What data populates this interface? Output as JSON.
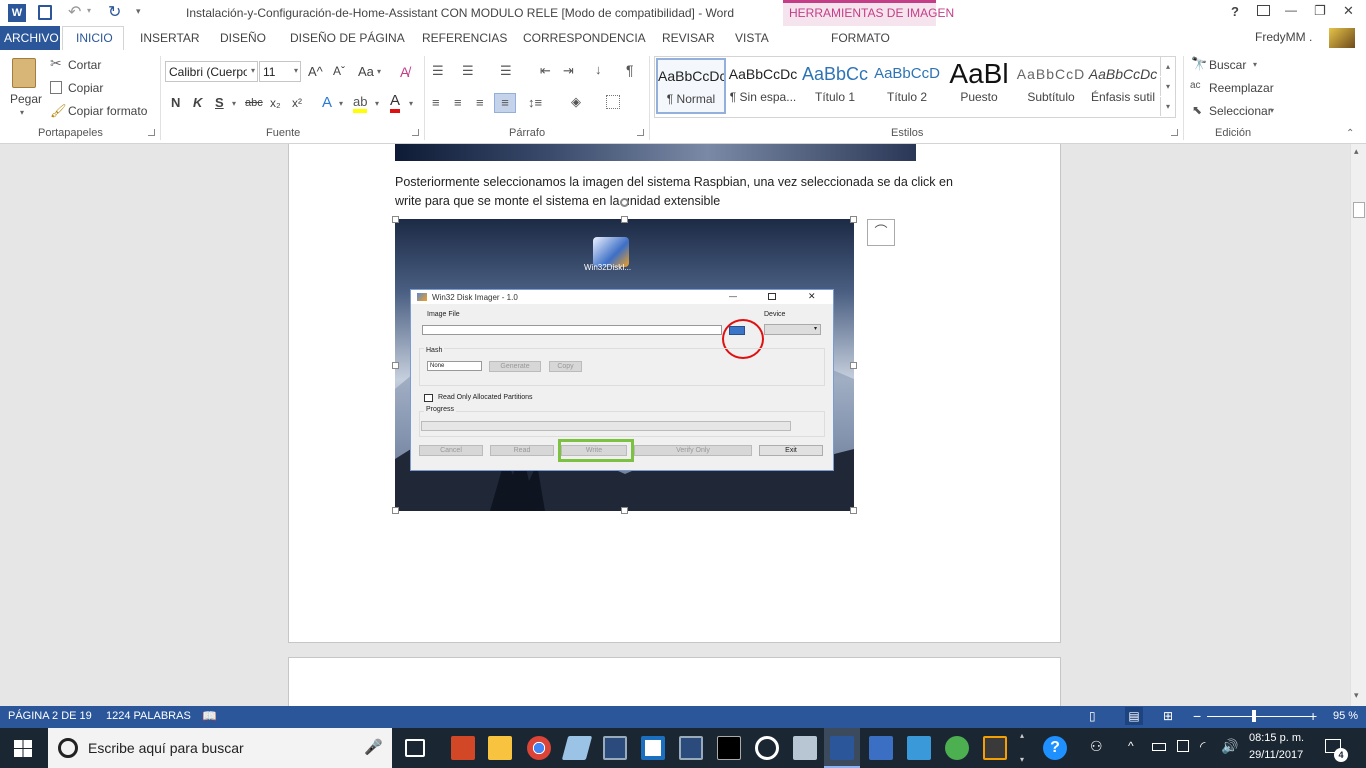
{
  "titlebar": {
    "title": "Instalación-y-Configuración-de-Home-Assistant CON MODULO RELE [Modo de compatibilidad] - Word",
    "contextual_group": "HERRAMIENTAS DE IMAGEN",
    "help": "?",
    "minimize": "—",
    "restore": "❐",
    "close": "✕"
  },
  "tabs": {
    "file": "ARCHIVO",
    "home": "INICIO",
    "insert": "INSERTAR",
    "design": "DISEÑO",
    "layout": "DISEÑO DE PÁGINA",
    "references": "REFERENCIAS",
    "mailings": "CORRESPONDENCIA",
    "review": "REVISAR",
    "view": "VISTA",
    "format": "FORMATO",
    "user": "FredyMM ."
  },
  "clipboard": {
    "paste": "Pegar",
    "cut": "Cortar",
    "copy": "Copiar",
    "format_painter": "Copiar formato",
    "label": "Portapapeles"
  },
  "font": {
    "name": "Calibri (Cuerpo",
    "size": "11",
    "bold": "N",
    "italic": "K",
    "underline": "S",
    "strike": "abc",
    "subscript": "x₂",
    "superscript": "x²",
    "grow": "A^",
    "shrink": "Aˇ",
    "case": "Aa",
    "label": "Fuente"
  },
  "paragraph": {
    "label": "Párrafo",
    "pilcrow": "¶"
  },
  "styles": {
    "items": [
      {
        "preview": "AaBbCcDc",
        "name": "¶ Normal"
      },
      {
        "preview": "AaBbCcDc",
        "name": "¶ Sin espa..."
      },
      {
        "preview": "AaBbCc",
        "name": "Título 1"
      },
      {
        "preview": "AaBbCcD",
        "name": "Título 2"
      },
      {
        "preview": "AaBl",
        "name": "Puesto"
      },
      {
        "preview": "AaBbCcD",
        "name": "Subtítulo"
      },
      {
        "preview": "AaBbCcDc",
        "name": "Énfasis sutil"
      }
    ],
    "label": "Estilos"
  },
  "editing": {
    "find": "Buscar",
    "replace": "Reemplazar",
    "select": "Seleccionar",
    "label": "Edición"
  },
  "document": {
    "paragraph_line1": "Posteriormente seleccionamos la imagen del sistema Raspbian, una vez seleccionada se da click en",
    "paragraph_line2": "write para que se monte el sistema en la unidad extensible"
  },
  "screenshot": {
    "desktop_icon_label": "Win32DiskI...",
    "dialog_title": "Win32 Disk Imager - 1.0",
    "image_file_label": "Image File",
    "device_label": "Device",
    "hash_label": "Hash",
    "hash_value": "None",
    "generate": "Generate",
    "copy": "Copy",
    "read_only": "Read Only Allocated Partitions",
    "progress_label": "Progress",
    "cancel": "Cancel",
    "read": "Read",
    "write": "Write",
    "verify": "Verify Only",
    "exit": "Exit"
  },
  "status": {
    "page": "PÁGINA 2 DE 19",
    "words": "1224 PALABRAS",
    "zoom": "95 %",
    "zoom_level_fraction": 0.43
  },
  "taskbar": {
    "search_placeholder": "Escribe aquí para buscar",
    "time": "08:15 p. m.",
    "date": "29/11/2017",
    "notifications": "4"
  },
  "colors": {
    "word_blue": "#2b579a",
    "contextual": "#c43e87",
    "circle_red": "#e01010",
    "write_green": "#7dc142"
  }
}
